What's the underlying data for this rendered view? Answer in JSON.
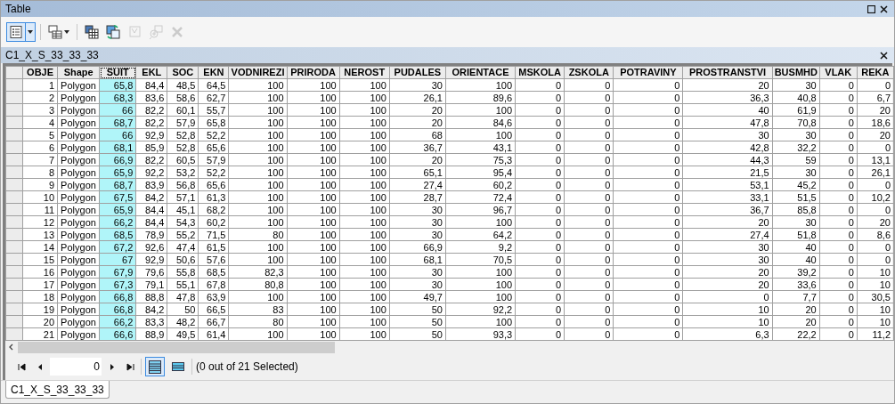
{
  "window": {
    "title": "Table"
  },
  "toolbar": [
    {
      "kind": "table-options",
      "dropdown": true,
      "selected": true,
      "disabled": false
    },
    {
      "kind": "related-tables",
      "dropdown": true,
      "selected": false,
      "disabled": false
    },
    {
      "kind": "select-by-attributes",
      "dropdown": false,
      "selected": false,
      "disabled": false
    },
    {
      "kind": "switch-selection",
      "dropdown": false,
      "selected": false,
      "disabled": false
    },
    {
      "kind": "clear-selection",
      "dropdown": false,
      "selected": false,
      "disabled": true
    },
    {
      "kind": "zoom-to-selected",
      "dropdown": false,
      "selected": false,
      "disabled": true
    },
    {
      "kind": "delete",
      "dropdown": false,
      "selected": false,
      "disabled": true
    }
  ],
  "table_title": "C1_X_S_33_33_33",
  "table": {
    "columns": [
      {
        "label": "OBJE",
        "kind": "number",
        "selected": false
      },
      {
        "label": "Shape",
        "kind": "text",
        "selected": false
      },
      {
        "label": "SUIT",
        "kind": "number",
        "selected": true
      },
      {
        "label": "EKL",
        "kind": "number",
        "selected": false
      },
      {
        "label": "SOC",
        "kind": "number",
        "selected": false
      },
      {
        "label": "EKN",
        "kind": "number",
        "selected": false
      },
      {
        "label": "VODNIREZI",
        "kind": "number",
        "selected": false
      },
      {
        "label": "PRIRODA",
        "kind": "number",
        "selected": false
      },
      {
        "label": "NEROST",
        "kind": "number",
        "selected": false
      },
      {
        "label": "PUDALES",
        "kind": "number",
        "selected": false
      },
      {
        "label": "ORIENTACE",
        "kind": "number",
        "selected": false
      },
      {
        "label": "MSKOLA",
        "kind": "number",
        "selected": false
      },
      {
        "label": "ZSKOLA",
        "kind": "number",
        "selected": false
      },
      {
        "label": "POTRAVINY",
        "kind": "number",
        "selected": false
      },
      {
        "label": "PROSTRANSTVI",
        "kind": "number",
        "selected": false
      },
      {
        "label": "BUSMHD",
        "kind": "number",
        "selected": false
      },
      {
        "label": "VLAK",
        "kind": "number",
        "selected": false
      },
      {
        "label": "REKA",
        "kind": "number",
        "selected": false
      }
    ],
    "rows": [
      [
        "1",
        "Polygon",
        "65,8",
        "84,4",
        "48,5",
        "64,5",
        "100",
        "100",
        "100",
        "30",
        "100",
        "0",
        "0",
        "0",
        "20",
        "30",
        "0",
        "0"
      ],
      [
        "2",
        "Polygon",
        "68,3",
        "83,6",
        "58,6",
        "62,7",
        "100",
        "100",
        "100",
        "26,1",
        "89,6",
        "0",
        "0",
        "0",
        "36,3",
        "40,8",
        "0",
        "6,7"
      ],
      [
        "3",
        "Polygon",
        "66",
        "82,2",
        "60,1",
        "55,7",
        "100",
        "100",
        "100",
        "20",
        "100",
        "0",
        "0",
        "0",
        "40",
        "61,9",
        "0",
        "20"
      ],
      [
        "4",
        "Polygon",
        "68,7",
        "82,2",
        "57,9",
        "65,8",
        "100",
        "100",
        "100",
        "20",
        "84,6",
        "0",
        "0",
        "0",
        "47,8",
        "70,8",
        "0",
        "18,6"
      ],
      [
        "5",
        "Polygon",
        "66",
        "92,9",
        "52,8",
        "52,2",
        "100",
        "100",
        "100",
        "68",
        "100",
        "0",
        "0",
        "0",
        "30",
        "30",
        "0",
        "20"
      ],
      [
        "6",
        "Polygon",
        "68,1",
        "85,9",
        "52,8",
        "65,6",
        "100",
        "100",
        "100",
        "36,7",
        "43,1",
        "0",
        "0",
        "0",
        "42,8",
        "32,2",
        "0",
        "0"
      ],
      [
        "7",
        "Polygon",
        "66,9",
        "82,2",
        "60,5",
        "57,9",
        "100",
        "100",
        "100",
        "20",
        "75,3",
        "0",
        "0",
        "0",
        "44,3",
        "59",
        "0",
        "13,1"
      ],
      [
        "8",
        "Polygon",
        "65,9",
        "92,2",
        "53,2",
        "52,2",
        "100",
        "100",
        "100",
        "65,1",
        "95,4",
        "0",
        "0",
        "0",
        "21,5",
        "30",
        "0",
        "26,1"
      ],
      [
        "9",
        "Polygon",
        "68,7",
        "83,9",
        "56,8",
        "65,6",
        "100",
        "100",
        "100",
        "27,4",
        "60,2",
        "0",
        "0",
        "0",
        "53,1",
        "45,2",
        "0",
        "0"
      ],
      [
        "10",
        "Polygon",
        "67,5",
        "84,2",
        "57,1",
        "61,3",
        "100",
        "100",
        "100",
        "28,7",
        "72,4",
        "0",
        "0",
        "0",
        "33,1",
        "51,5",
        "0",
        "10,2"
      ],
      [
        "11",
        "Polygon",
        "65,9",
        "84,4",
        "45,1",
        "68,2",
        "100",
        "100",
        "100",
        "30",
        "96,7",
        "0",
        "0",
        "0",
        "36,7",
        "85,8",
        "0",
        "0"
      ],
      [
        "12",
        "Polygon",
        "66,2",
        "84,4",
        "54,3",
        "60,2",
        "100",
        "100",
        "100",
        "30",
        "100",
        "0",
        "0",
        "0",
        "20",
        "30",
        "0",
        "20"
      ],
      [
        "13",
        "Polygon",
        "68,5",
        "78,9",
        "55,2",
        "71,5",
        "80",
        "100",
        "100",
        "30",
        "64,2",
        "0",
        "0",
        "0",
        "27,4",
        "51,8",
        "0",
        "8,6"
      ],
      [
        "14",
        "Polygon",
        "67,2",
        "92,6",
        "47,4",
        "61,5",
        "100",
        "100",
        "100",
        "66,9",
        "9,2",
        "0",
        "0",
        "0",
        "30",
        "40",
        "0",
        "0"
      ],
      [
        "15",
        "Polygon",
        "67",
        "92,9",
        "50,6",
        "57,6",
        "100",
        "100",
        "100",
        "68,1",
        "70,5",
        "0",
        "0",
        "0",
        "30",
        "40",
        "0",
        "0"
      ],
      [
        "16",
        "Polygon",
        "67,9",
        "79,6",
        "55,8",
        "68,5",
        "82,3",
        "100",
        "100",
        "30",
        "100",
        "0",
        "0",
        "0",
        "20",
        "39,2",
        "0",
        "10"
      ],
      [
        "17",
        "Polygon",
        "67,3",
        "79,1",
        "55,1",
        "67,8",
        "80,8",
        "100",
        "100",
        "30",
        "100",
        "0",
        "0",
        "0",
        "20",
        "33,6",
        "0",
        "10"
      ],
      [
        "18",
        "Polygon",
        "66,8",
        "88,8",
        "47,8",
        "63,9",
        "100",
        "100",
        "100",
        "49,7",
        "100",
        "0",
        "0",
        "0",
        "0",
        "7,7",
        "0",
        "30,5"
      ],
      [
        "19",
        "Polygon",
        "66,8",
        "84,2",
        "50",
        "66,5",
        "83",
        "100",
        "100",
        "50",
        "92,2",
        "0",
        "0",
        "0",
        "10",
        "20",
        "0",
        "10"
      ],
      [
        "20",
        "Polygon",
        "66,2",
        "83,3",
        "48,2",
        "66,7",
        "80",
        "100",
        "100",
        "50",
        "100",
        "0",
        "0",
        "0",
        "10",
        "20",
        "0",
        "10"
      ],
      [
        "21",
        "Polygon",
        "66,6",
        "88,9",
        "49,5",
        "61,4",
        "100",
        "100",
        "100",
        "50",
        "93,3",
        "0",
        "0",
        "0",
        "6,3",
        "22,2",
        "0",
        "11,2"
      ]
    ]
  },
  "navigator": {
    "record": "0",
    "views": [
      {
        "kind": "all",
        "selected": true
      },
      {
        "kind": "selected",
        "selected": false
      }
    ],
    "status": "(0 out of 21 Selected)"
  },
  "tabs": [
    {
      "label": "C1_X_S_33_33_33",
      "selected": true
    }
  ]
}
